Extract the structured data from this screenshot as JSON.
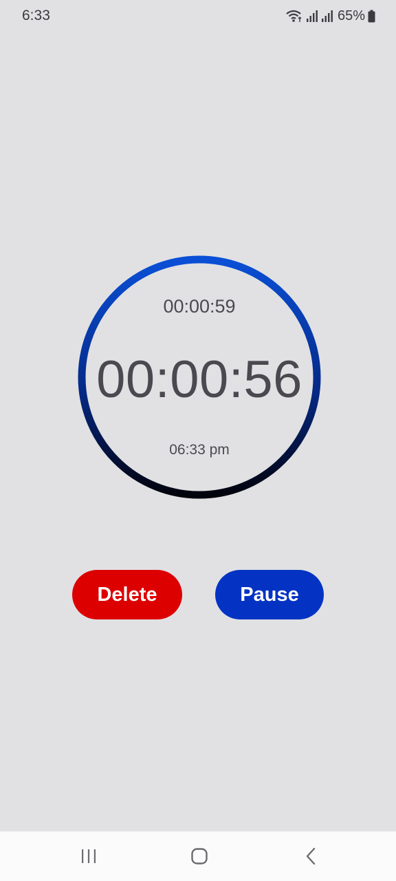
{
  "status_bar": {
    "time": "6:33",
    "battery_percent": "65%",
    "icons": [
      "wifi-icon",
      "signal-icon",
      "signal-icon",
      "battery-icon"
    ]
  },
  "timer": {
    "total": "00:00:59",
    "remaining": "00:00:56",
    "ends_at": "06:33 pm",
    "ring_colors": {
      "top": "#0a4fd6",
      "bottom": "#01030c"
    }
  },
  "buttons": {
    "delete_label": "Delete",
    "pause_label": "Pause",
    "delete_color": "#dd0000",
    "pause_color": "#0433c4"
  },
  "nav": {
    "icons": [
      "recents-icon",
      "home-icon",
      "back-icon"
    ]
  }
}
